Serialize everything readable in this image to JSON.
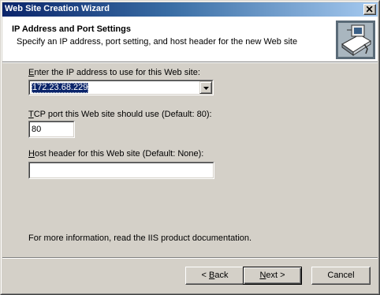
{
  "window": {
    "title": "Web Site Creation Wizard"
  },
  "header": {
    "title": "IP Address and Port Settings",
    "subtitle": "Specify an IP address, port setting, and host header for the new Web site"
  },
  "ip": {
    "label_key": "E",
    "label_rest": "nter the IP address to use for this Web site:",
    "value": "172.23.68.229"
  },
  "port": {
    "label_key": "T",
    "label_rest": "CP port this Web site should use (Default: 80):",
    "value": "80"
  },
  "host": {
    "label_key": "H",
    "label_rest": "ost header for this Web site (Default: None):",
    "value": ""
  },
  "info_text": "For more information, read the IIS product documentation.",
  "buttons": {
    "back_prefix": "< ",
    "back_key": "B",
    "back_rest": "ack",
    "next_key": "N",
    "next_rest": "ext >",
    "cancel": "Cancel"
  },
  "colors": {
    "title_gradient_start": "#0a246a",
    "title_gradient_end": "#a6caf0",
    "selection": "#0a246a",
    "face": "#d4d0c8"
  },
  "icons": {
    "close": "close-icon",
    "dropdown": "chevron-down-icon",
    "wizard": "wizard-icon"
  }
}
